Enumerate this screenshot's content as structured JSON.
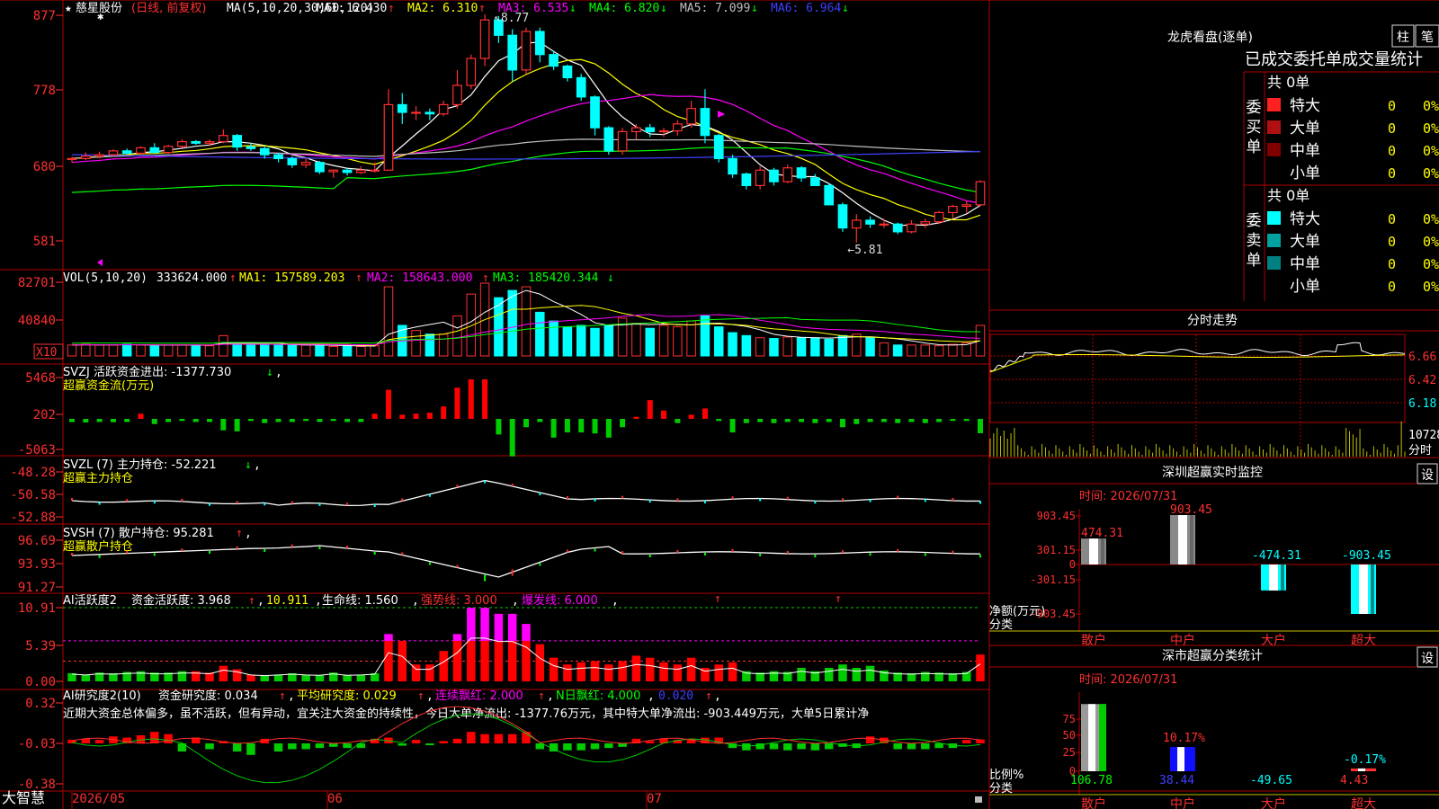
{
  "colors": {
    "up": "#ff3030",
    "down": "#00ffff",
    "grid": "#b00000",
    "ma1": "#ffffff",
    "ma2": "#ffff00",
    "ma3": "#ff00ff",
    "ma4": "#00ff00",
    "ma5": "#c0c0c0",
    "ma6": "#4040ff",
    "vma3": "#00ff00"
  },
  "kline": {
    "header": {
      "star": "★",
      "name": "慈星股份",
      "mode": "(日线, 前复权)",
      "ma_params": "MA(5,10,20,30,60,120)",
      "ma": [
        {
          "label": "MA1: 6.430",
          "arrow": "↑"
        },
        {
          "label": "MA2: 6.310",
          "arrow": "↑"
        },
        {
          "label": "MA3: 6.535",
          "arrow": "↓"
        },
        {
          "label": "MA4: 6.820",
          "arrow": "↓"
        },
        {
          "label": "MA5: 7.099",
          "arrow": "↓"
        },
        {
          "label": "MA6: 6.964",
          "arrow": "↓"
        }
      ]
    },
    "yticks": [
      "877",
      "778",
      "680",
      "581"
    ],
    "high_label": "8.77",
    "low_label": "5.81",
    "high_arrow": "↖",
    "low_arrow": "←",
    "dates": [
      "2026/05",
      "06",
      "07"
    ],
    "candles": [
      [
        6.9,
        6.92,
        6.85,
        6.9
      ],
      [
        6.9,
        6.98,
        6.88,
        6.93
      ],
      [
        6.93,
        6.99,
        6.9,
        6.95
      ],
      [
        6.95,
        7.02,
        6.93,
        7.0
      ],
      [
        7.0,
        7.03,
        6.95,
        6.97
      ],
      [
        6.97,
        7.06,
        6.95,
        7.04
      ],
      [
        7.04,
        7.1,
        7.0,
        6.98
      ],
      [
        6.98,
        7.08,
        6.96,
        7.06
      ],
      [
        7.06,
        7.15,
        7.04,
        7.12
      ],
      [
        7.12,
        7.14,
        7.08,
        7.1
      ],
      [
        7.1,
        7.15,
        7.06,
        7.12
      ],
      [
        7.12,
        7.28,
        7.1,
        7.2
      ],
      [
        7.2,
        7.22,
        7.0,
        7.05
      ],
      [
        7.05,
        7.1,
        7.0,
        7.03
      ],
      [
        7.03,
        7.06,
        6.9,
        6.95
      ],
      [
        6.95,
        6.97,
        6.85,
        6.9
      ],
      [
        6.9,
        6.93,
        6.78,
        6.82
      ],
      [
        6.82,
        6.9,
        6.78,
        6.85
      ],
      [
        6.85,
        6.87,
        6.7,
        6.73
      ],
      [
        6.73,
        6.76,
        6.65,
        6.75
      ],
      [
        6.75,
        6.78,
        6.68,
        6.72
      ],
      [
        6.72,
        6.8,
        6.7,
        6.75
      ],
      [
        6.75,
        6.85,
        6.72,
        6.75
      ],
      [
        6.75,
        7.8,
        6.74,
        7.6
      ],
      [
        7.6,
        7.75,
        7.35,
        7.5
      ],
      [
        7.5,
        7.58,
        7.4,
        7.5
      ],
      [
        7.5,
        7.55,
        7.4,
        7.48
      ],
      [
        7.48,
        7.65,
        7.45,
        7.6
      ],
      [
        7.6,
        8.05,
        7.55,
        7.85
      ],
      [
        7.85,
        8.25,
        7.8,
        8.2
      ],
      [
        8.2,
        8.77,
        8.1,
        8.7
      ],
      [
        8.7,
        8.75,
        8.4,
        8.5
      ],
      [
        8.5,
        8.58,
        7.9,
        8.05
      ],
      [
        8.05,
        8.6,
        8.0,
        8.55
      ],
      [
        8.55,
        8.6,
        8.15,
        8.25
      ],
      [
        8.25,
        8.3,
        8.05,
        8.1
      ],
      [
        8.1,
        8.12,
        7.9,
        7.95
      ],
      [
        7.95,
        8.0,
        7.65,
        7.7
      ],
      [
        7.7,
        7.72,
        7.2,
        7.3
      ],
      [
        7.3,
        7.32,
        6.95,
        7.0
      ],
      [
        7.0,
        7.3,
        6.95,
        7.25
      ],
      [
        7.25,
        7.35,
        7.15,
        7.3
      ],
      [
        7.3,
        7.35,
        7.18,
        7.25
      ],
      [
        7.25,
        7.3,
        7.18,
        7.26
      ],
      [
        7.26,
        7.4,
        7.2,
        7.35
      ],
      [
        7.35,
        7.65,
        7.3,
        7.55
      ],
      [
        7.55,
        7.8,
        7.1,
        7.2
      ],
      [
        7.2,
        7.22,
        6.85,
        6.9
      ],
      [
        6.9,
        6.95,
        6.65,
        6.7
      ],
      [
        6.7,
        6.72,
        6.5,
        6.55
      ],
      [
        6.55,
        6.8,
        6.5,
        6.75
      ],
      [
        6.75,
        6.78,
        6.55,
        6.6
      ],
      [
        6.6,
        6.82,
        6.58,
        6.78
      ],
      [
        6.78,
        6.8,
        6.6,
        6.65
      ],
      [
        6.65,
        6.7,
        6.55,
        6.55
      ],
      [
        6.55,
        6.58,
        6.3,
        6.3
      ],
      [
        6.3,
        6.33,
        5.95,
        6.0
      ],
      [
        6.0,
        6.18,
        5.81,
        6.1
      ],
      [
        6.1,
        6.15,
        6.0,
        6.05
      ],
      [
        6.05,
        6.12,
        6.0,
        6.05
      ],
      [
        6.05,
        6.07,
        5.92,
        5.95
      ],
      [
        5.95,
        6.1,
        5.93,
        6.05
      ],
      [
        6.05,
        6.12,
        6.0,
        6.08
      ],
      [
        6.08,
        6.22,
        6.05,
        6.2
      ],
      [
        6.2,
        6.3,
        6.12,
        6.28
      ],
      [
        6.28,
        6.35,
        6.2,
        6.3
      ],
      [
        6.3,
        6.62,
        6.28,
        6.6
      ]
    ]
  },
  "vol": {
    "header": "VOL(5,10,20)",
    "value": "333624.000",
    "ma1": "MA1: 157589.203",
    "ma2": "MA2: 158643.000",
    "ma3": "MA3: 185420.344",
    "arrow_up": "↑",
    "arrow_down": "↓",
    "yticks": [
      "82701",
      "40840"
    ],
    "x10": "X10",
    "bars": [
      0.15,
      0.16,
      0.15,
      0.15,
      0.16,
      0.15,
      0.14,
      0.15,
      0.15,
      0.15,
      0.14,
      0.28,
      0.16,
      0.15,
      0.15,
      0.16,
      0.15,
      0.15,
      0.14,
      0.13,
      0.14,
      0.13,
      0.14,
      0.95,
      0.42,
      0.35,
      0.3,
      0.3,
      0.55,
      0.85,
      1.0,
      0.8,
      0.9,
      0.95,
      0.6,
      0.48,
      0.4,
      0.42,
      0.38,
      0.42,
      0.52,
      0.45,
      0.38,
      0.42,
      0.4,
      0.48,
      0.55,
      0.4,
      0.32,
      0.28,
      0.25,
      0.24,
      0.26,
      0.25,
      0.25,
      0.23,
      0.28,
      0.3,
      0.26,
      0.18,
      0.15,
      0.15,
      0.15,
      0.14,
      0.16,
      0.18,
      0.42
    ]
  },
  "svzj": {
    "header": "SVZJ  活跃资金进出: -1377.730",
    "arrow": "↓",
    "comma": ",",
    "sub": "超赢资金流(万元)",
    "yticks": [
      "5468",
      "202",
      "-5063"
    ],
    "values": [
      -300,
      -350,
      -300,
      -320,
      -300,
      500,
      -500,
      -300,
      -200,
      -300,
      -300,
      -1100,
      -1200,
      -200,
      -400,
      -300,
      -300,
      -200,
      -300,
      -200,
      -300,
      -300,
      500,
      2800,
      400,
      500,
      600,
      1200,
      3000,
      3800,
      3800,
      -1500,
      -3600,
      -800,
      -300,
      -1800,
      -1300,
      -1300,
      -1400,
      -1800,
      -800,
      200,
      1800,
      800,
      -400,
      400,
      1000,
      -200,
      -1300,
      -400,
      -300,
      -400,
      -300,
      -300,
      -400,
      -300,
      -800,
      -500,
      -300,
      -300,
      -400,
      -300,
      -400,
      -300,
      -200,
      -200,
      -1377
    ]
  },
  "svzl": {
    "header": "SVZL (7) 主力持仓: -52.221",
    "arrow": "↓",
    "comma": ",",
    "sub": "超赢主力持仓",
    "yticks": [
      "-48.28",
      "-50.58",
      "-52.88"
    ]
  },
  "svsh": {
    "header": "SVSH (7) 散户持仓: 95.281",
    "arrow": "↑",
    "comma": ",",
    "sub": "超赢散户持仓",
    "yticks": [
      "96.69",
      "93.93",
      "91.27"
    ]
  },
  "ai1": {
    "header": {
      "name": "AI活跃度2",
      "p1": "资金活跃度: 3.968",
      "p2": "10.911",
      "p3": "生命线: 1.560",
      "p4": "强势线: 3.000",
      "p5": "爆发线: 6.000",
      "arrow": "↑",
      "comma": ","
    },
    "yticks": [
      "10.91",
      "5.39",
      "0.00"
    ],
    "values": [
      -1.2,
      -1.0,
      -1.3,
      -1.2,
      -1.4,
      -1.5,
      -1.3,
      -1.3,
      -1.5,
      1.5,
      1.3,
      2.3,
      1.8,
      1.0,
      -0.8,
      -1.0,
      -1.2,
      -1.0,
      -0.9,
      -1.3,
      -0.9,
      -1.0,
      -1.2,
      7.0,
      6.0,
      2.5,
      2.5,
      4.5,
      7.0,
      10.9,
      10.9,
      10.0,
      10.0,
      8.5,
      5.5,
      3.5,
      2.5,
      2.8,
      3.0,
      2.5,
      3.0,
      3.8,
      3.5,
      2.8,
      2.5,
      3.5,
      2.0,
      2.5,
      2.8,
      -1.5,
      -1.3,
      -1.5,
      -1.4,
      -2.0,
      -1.5,
      -2.0,
      -2.5,
      -2.0,
      -2.3,
      -1.6,
      -1.3,
      -1.2,
      -1.4,
      -1.3,
      -1.2,
      -1.4,
      3.968
    ]
  },
  "ai2": {
    "header": {
      "name": "AI研究度2(10)",
      "p1": "资金研究度: 0.034",
      "p2": "平均研究度: 0.029",
      "p3": "连续飘红: 2.000",
      "p4": "N日飘红: 4.000",
      "p5": "0.020",
      "arrow": "↑",
      "comma": ","
    },
    "text": "近期大资金总体偏多，虽不活跃，但有异动，宜关注大资金的持续性，今日大单净流出: -1377.76万元，其中特大单净流出: -903.449万元，大单5日累计净",
    "yticks": [
      "0.32",
      "-0.03",
      "-0.38"
    ],
    "values": [
      0.03,
      0.04,
      0.03,
      0.06,
      0.05,
      0.07,
      0.1,
      0.08,
      -0.07,
      0.05,
      -0.05,
      0.02,
      -0.07,
      -0.1,
      0.04,
      -0.07,
      -0.05,
      -0.05,
      -0.04,
      -0.03,
      -0.04,
      -0.04,
      0.04,
      0.05,
      -0.02,
      0.03,
      -0.01,
      0.02,
      0.04,
      0.1,
      0.08,
      0.08,
      0.08,
      0.1,
      -0.05,
      -0.07,
      -0.06,
      -0.06,
      -0.05,
      -0.04,
      -0.03,
      0.04,
      0.02,
      0.04,
      0.03,
      0.04,
      0.05,
      0.05,
      -0.04,
      -0.06,
      -0.05,
      -0.05,
      -0.06,
      -0.05,
      -0.06,
      -0.05,
      -0.03,
      -0.04,
      0.06,
      0.05,
      -0.05,
      -0.05,
      -0.05,
      -0.04,
      -0.04,
      0.03,
      0.034
    ]
  },
  "footer": {
    "brand": "大智慧"
  },
  "right": {
    "lhb": {
      "title": "龙虎看盘(逐单)",
      "btn_col": "柱",
      "btn_pen": "笔",
      "stats_title": "已成交委托单成交量统计",
      "buy": {
        "side": "委买单",
        "total": "共 0单",
        "rows": [
          {
            "name": "特大",
            "v": "0",
            "p": "0%",
            "c": "#ff2020"
          },
          {
            "name": "大单",
            "v": "0",
            "p": "0%",
            "c": "#b01010"
          },
          {
            "name": "中单",
            "v": "0",
            "p": "0%",
            "c": "#800000"
          },
          {
            "name": "小单",
            "v": "0",
            "p": "0%",
            "c": ""
          }
        ]
      },
      "sell": {
        "side": "委卖单",
        "total": "共 0单",
        "rows": [
          {
            "name": "特大",
            "v": "0",
            "p": "0%",
            "c": "#00ffff"
          },
          {
            "name": "大单",
            "v": "0",
            "p": "0%",
            "c": "#00a0a0"
          },
          {
            "name": "中单",
            "v": "0",
            "p": "0%",
            "c": "#008080"
          },
          {
            "name": "小单",
            "v": "0",
            "p": "0%",
            "c": ""
          }
        ]
      }
    },
    "intraday": {
      "title": "分时走势",
      "yticks": [
        "6.66",
        "6.42",
        "6.18"
      ],
      "vol_label": "10728",
      "vol_unit": "分时"
    },
    "sz_monitor": {
      "title": "深圳超赢实时监控",
      "btn": "设",
      "time": "时间: 2026/07/31",
      "yticks": [
        "903.45",
        "301.15",
        "0",
        "-301.15",
        "-903.45"
      ],
      "ylabel": "净额(万元)",
      "xlabel": "分类",
      "cats": [
        "散户",
        "中户",
        "大户",
        "超大"
      ],
      "values": [
        474.31,
        903.45,
        -474.31,
        -903.45
      ],
      "labels": [
        "474.31",
        "903.45",
        "-474.31",
        "-903.45"
      ]
    },
    "sz_class": {
      "title": "深市超赢分类统计",
      "btn": "设",
      "time": "时间: 2026/07/31",
      "yticks": [
        "75",
        "50",
        "25",
        "0"
      ],
      "ylabel": "比例%",
      "xlabel": "分类",
      "cats": [
        "散户",
        "中户",
        "大户",
        "超大"
      ],
      "values": [
        106.78,
        38.44,
        -49.65,
        4.43
      ],
      "labels": [
        "106.78",
        "38.44",
        "-49.65",
        "4.43"
      ],
      "top_labels": [
        "",
        "10.17%",
        "",
        "-0.17%"
      ]
    }
  }
}
